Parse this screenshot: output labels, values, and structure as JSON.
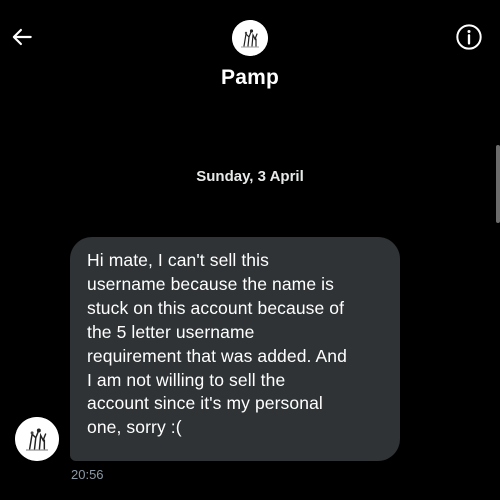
{
  "header": {
    "back_icon": "arrow-left-icon",
    "info_icon": "info-circle-icon",
    "contact_name": "Pamp",
    "avatar_icon": "avatar-sketch"
  },
  "conversation": {
    "date_separator": "Sunday, 3 April",
    "messages": [
      {
        "sender": "Pamp",
        "lines": [
          "Hi mate, I can't sell this",
          "username because the name is",
          "stuck on this account because of",
          "the 5 letter username",
          "requirement that was added. And",
          "I am not willing to sell the",
          "account since it's my personal",
          "one, sorry :("
        ],
        "time": "20:56"
      }
    ]
  },
  "colors": {
    "background": "#000000",
    "bubble": "#2f3336",
    "text": "#ffffff",
    "timestamp": "#8b98a5"
  }
}
